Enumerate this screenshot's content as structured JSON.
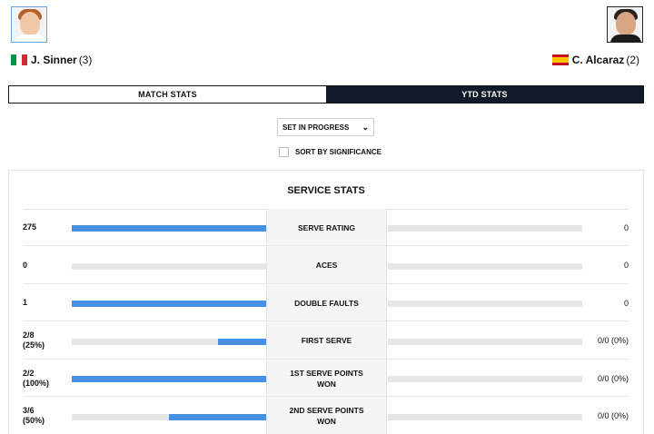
{
  "players": {
    "left": {
      "name": "J. Sinner",
      "seed": "(3)",
      "flag": "italy-flag",
      "flag_colors": [
        "#009246",
        "#ffffff",
        "#ce2b37"
      ],
      "avatar": "player-photo",
      "avatar_colors": {
        "hair": "#b5612a",
        "skin": "#f0c8a8",
        "shirt": "#ffffff"
      }
    },
    "right": {
      "name": "C. Alcaraz",
      "seed": "(2)",
      "flag": "spain-flag",
      "flag_colors": [
        "#c60b1e",
        "#ffc400",
        "#c60b1e"
      ],
      "avatar": "player-photo",
      "avatar_colors": {
        "hair": "#2a2220",
        "skin": "#d9a684",
        "shirt": "#1b1b1b"
      }
    }
  },
  "tabs": [
    {
      "label": "MATCH STATS",
      "active": false
    },
    {
      "label": "YTD STATS",
      "active": true
    }
  ],
  "filter": {
    "set_select": "SET IN PROGRESS",
    "sort_label": "SORT BY SIGNIFICANCE",
    "sort_checked": false
  },
  "section": {
    "title": "SERVICE STATS"
  },
  "colors": {
    "accent": "#4a90e2",
    "tab_active_bg": "#111a2a",
    "track": "#e6e6e6"
  },
  "stats": [
    {
      "label": "SERVE RATING",
      "left": "275",
      "right": "0",
      "left_frac": 1.0,
      "right_frac": 0.0
    },
    {
      "label": "ACES",
      "left": "0",
      "right": "0",
      "left_frac": 0.0,
      "right_frac": 0.0
    },
    {
      "label": "DOUBLE FAULTS",
      "left": "1",
      "right": "0",
      "left_frac": 1.0,
      "right_frac": 0.0
    },
    {
      "label": "FIRST SERVE",
      "left": "2/8\n(25%)",
      "right": "0/0 (0%)",
      "left_frac": 0.25,
      "right_frac": 0.0
    },
    {
      "label": "1ST SERVE POINTS\nWON",
      "left": "2/2\n(100%)",
      "right": "0/0 (0%)",
      "left_frac": 1.0,
      "right_frac": 0.0
    },
    {
      "label": "2ND SERVE POINTS\nWON",
      "left": "3/6\n(50%)",
      "right": "0/0 (0%)",
      "left_frac": 0.5,
      "right_frac": 0.0
    }
  ]
}
